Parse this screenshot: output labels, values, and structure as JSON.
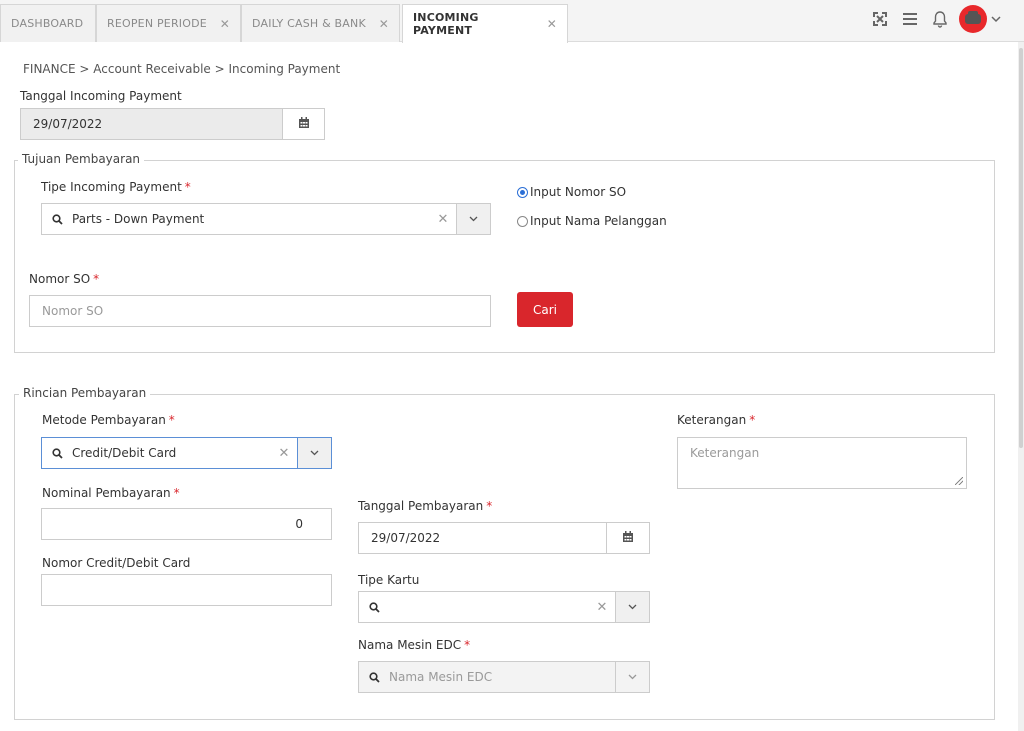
{
  "tabs": [
    {
      "label": "DASHBOARD",
      "closable": false
    },
    {
      "label": "REOPEN PERIODE",
      "closable": true
    },
    {
      "label": "DAILY CASH & BANK",
      "closable": true
    },
    {
      "label": "INCOMING PAYMENT",
      "closable": true,
      "active": true
    }
  ],
  "header_icons": [
    "fullscreen-icon",
    "menu-icon",
    "bell-icon",
    "avatar",
    "chevron-down-icon"
  ],
  "breadcrumb": "FINANCE > Account Receivable > Incoming Payment",
  "tanggal_incoming": {
    "label": "Tanggal Incoming Payment",
    "value": "29/07/2022"
  },
  "tujuan": {
    "legend": "Tujuan Pembayaran",
    "tipe_label": "Tipe Incoming Payment",
    "tipe_value": "Parts - Down Payment",
    "radio_so": "Input Nomor SO",
    "radio_pelanggan": "Input Nama Pelanggan",
    "radio_selected": "so",
    "nomor_so_label": "Nomor SO",
    "nomor_so_placeholder": "Nomor SO",
    "cari_button": "Cari"
  },
  "rincian": {
    "legend": "Rincian Pembayaran",
    "metode_label": "Metode Pembayaran",
    "metode_value": "Credit/Debit Card",
    "nominal_label": "Nominal Pembayaran",
    "nominal_value": "0",
    "nomor_card_label": "Nomor Credit/Debit Card",
    "nomor_card_value": "",
    "tanggal_label": "Tanggal Pembayaran",
    "tanggal_value": "29/07/2022",
    "tipe_kartu_label": "Tipe Kartu",
    "tipe_kartu_value": "",
    "mesin_label": "Nama Mesin EDC",
    "mesin_placeholder": "Nama Mesin EDC",
    "keterangan_label": "Keterangan",
    "keterangan_placeholder": "Keterangan"
  },
  "required_mark": "*",
  "colors": {
    "accent": "#d9262c",
    "focus": "#5b8fd6",
    "radio": "#2b6fd6"
  }
}
